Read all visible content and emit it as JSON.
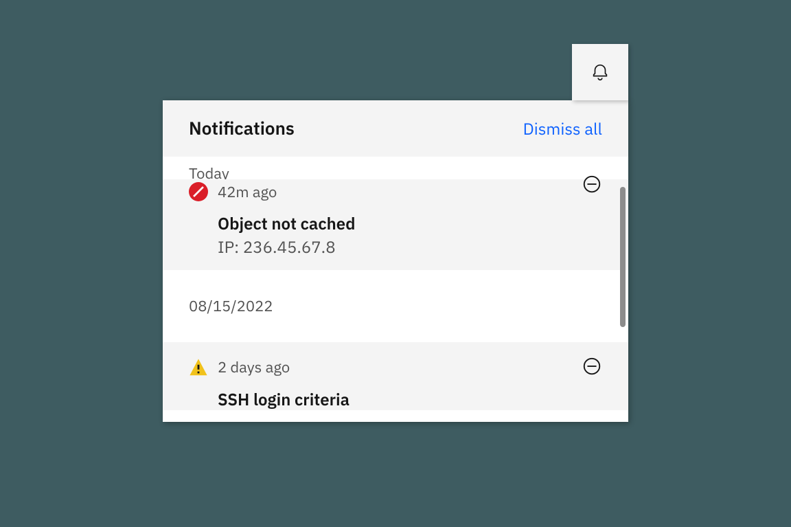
{
  "header": {
    "title": "Notifications",
    "dismiss_all": "Dismiss all"
  },
  "sections": {
    "today": "Today",
    "date1": "08/15/2022"
  },
  "notif1": {
    "time": "42m ago",
    "title": "Object not cached",
    "subtitle": "IP: 236.45.67.8",
    "icon_type": "error"
  },
  "notif2": {
    "time": "2 days ago",
    "title": "SSH login criteria",
    "icon_type": "warning"
  },
  "colors": {
    "accent": "#0f62fe",
    "error": "#da1e28",
    "warning": "#f1c21b",
    "text": "#161616",
    "text_secondary": "#525252"
  }
}
